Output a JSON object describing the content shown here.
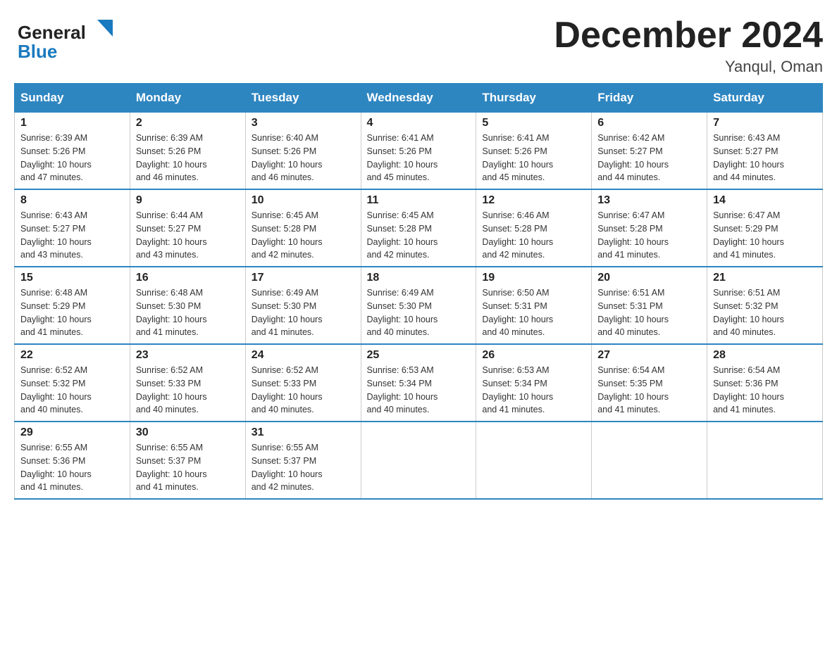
{
  "header": {
    "logo_general": "General",
    "logo_blue": "Blue",
    "month_title": "December 2024",
    "location": "Yanqul, Oman"
  },
  "days_of_week": [
    "Sunday",
    "Monday",
    "Tuesday",
    "Wednesday",
    "Thursday",
    "Friday",
    "Saturday"
  ],
  "weeks": [
    [
      {
        "day": "1",
        "sunrise": "6:39 AM",
        "sunset": "5:26 PM",
        "daylight": "10 hours and 47 minutes."
      },
      {
        "day": "2",
        "sunrise": "6:39 AM",
        "sunset": "5:26 PM",
        "daylight": "10 hours and 46 minutes."
      },
      {
        "day": "3",
        "sunrise": "6:40 AM",
        "sunset": "5:26 PM",
        "daylight": "10 hours and 46 minutes."
      },
      {
        "day": "4",
        "sunrise": "6:41 AM",
        "sunset": "5:26 PM",
        "daylight": "10 hours and 45 minutes."
      },
      {
        "day": "5",
        "sunrise": "6:41 AM",
        "sunset": "5:26 PM",
        "daylight": "10 hours and 45 minutes."
      },
      {
        "day": "6",
        "sunrise": "6:42 AM",
        "sunset": "5:27 PM",
        "daylight": "10 hours and 44 minutes."
      },
      {
        "day": "7",
        "sunrise": "6:43 AM",
        "sunset": "5:27 PM",
        "daylight": "10 hours and 44 minutes."
      }
    ],
    [
      {
        "day": "8",
        "sunrise": "6:43 AM",
        "sunset": "5:27 PM",
        "daylight": "10 hours and 43 minutes."
      },
      {
        "day": "9",
        "sunrise": "6:44 AM",
        "sunset": "5:27 PM",
        "daylight": "10 hours and 43 minutes."
      },
      {
        "day": "10",
        "sunrise": "6:45 AM",
        "sunset": "5:28 PM",
        "daylight": "10 hours and 42 minutes."
      },
      {
        "day": "11",
        "sunrise": "6:45 AM",
        "sunset": "5:28 PM",
        "daylight": "10 hours and 42 minutes."
      },
      {
        "day": "12",
        "sunrise": "6:46 AM",
        "sunset": "5:28 PM",
        "daylight": "10 hours and 42 minutes."
      },
      {
        "day": "13",
        "sunrise": "6:47 AM",
        "sunset": "5:28 PM",
        "daylight": "10 hours and 41 minutes."
      },
      {
        "day": "14",
        "sunrise": "6:47 AM",
        "sunset": "5:29 PM",
        "daylight": "10 hours and 41 minutes."
      }
    ],
    [
      {
        "day": "15",
        "sunrise": "6:48 AM",
        "sunset": "5:29 PM",
        "daylight": "10 hours and 41 minutes."
      },
      {
        "day": "16",
        "sunrise": "6:48 AM",
        "sunset": "5:30 PM",
        "daylight": "10 hours and 41 minutes."
      },
      {
        "day": "17",
        "sunrise": "6:49 AM",
        "sunset": "5:30 PM",
        "daylight": "10 hours and 41 minutes."
      },
      {
        "day": "18",
        "sunrise": "6:49 AM",
        "sunset": "5:30 PM",
        "daylight": "10 hours and 40 minutes."
      },
      {
        "day": "19",
        "sunrise": "6:50 AM",
        "sunset": "5:31 PM",
        "daylight": "10 hours and 40 minutes."
      },
      {
        "day": "20",
        "sunrise": "6:51 AM",
        "sunset": "5:31 PM",
        "daylight": "10 hours and 40 minutes."
      },
      {
        "day": "21",
        "sunrise": "6:51 AM",
        "sunset": "5:32 PM",
        "daylight": "10 hours and 40 minutes."
      }
    ],
    [
      {
        "day": "22",
        "sunrise": "6:52 AM",
        "sunset": "5:32 PM",
        "daylight": "10 hours and 40 minutes."
      },
      {
        "day": "23",
        "sunrise": "6:52 AM",
        "sunset": "5:33 PM",
        "daylight": "10 hours and 40 minutes."
      },
      {
        "day": "24",
        "sunrise": "6:52 AM",
        "sunset": "5:33 PM",
        "daylight": "10 hours and 40 minutes."
      },
      {
        "day": "25",
        "sunrise": "6:53 AM",
        "sunset": "5:34 PM",
        "daylight": "10 hours and 40 minutes."
      },
      {
        "day": "26",
        "sunrise": "6:53 AM",
        "sunset": "5:34 PM",
        "daylight": "10 hours and 41 minutes."
      },
      {
        "day": "27",
        "sunrise": "6:54 AM",
        "sunset": "5:35 PM",
        "daylight": "10 hours and 41 minutes."
      },
      {
        "day": "28",
        "sunrise": "6:54 AM",
        "sunset": "5:36 PM",
        "daylight": "10 hours and 41 minutes."
      }
    ],
    [
      {
        "day": "29",
        "sunrise": "6:55 AM",
        "sunset": "5:36 PM",
        "daylight": "10 hours and 41 minutes."
      },
      {
        "day": "30",
        "sunrise": "6:55 AM",
        "sunset": "5:37 PM",
        "daylight": "10 hours and 41 minutes."
      },
      {
        "day": "31",
        "sunrise": "6:55 AM",
        "sunset": "5:37 PM",
        "daylight": "10 hours and 42 minutes."
      },
      null,
      null,
      null,
      null
    ]
  ]
}
